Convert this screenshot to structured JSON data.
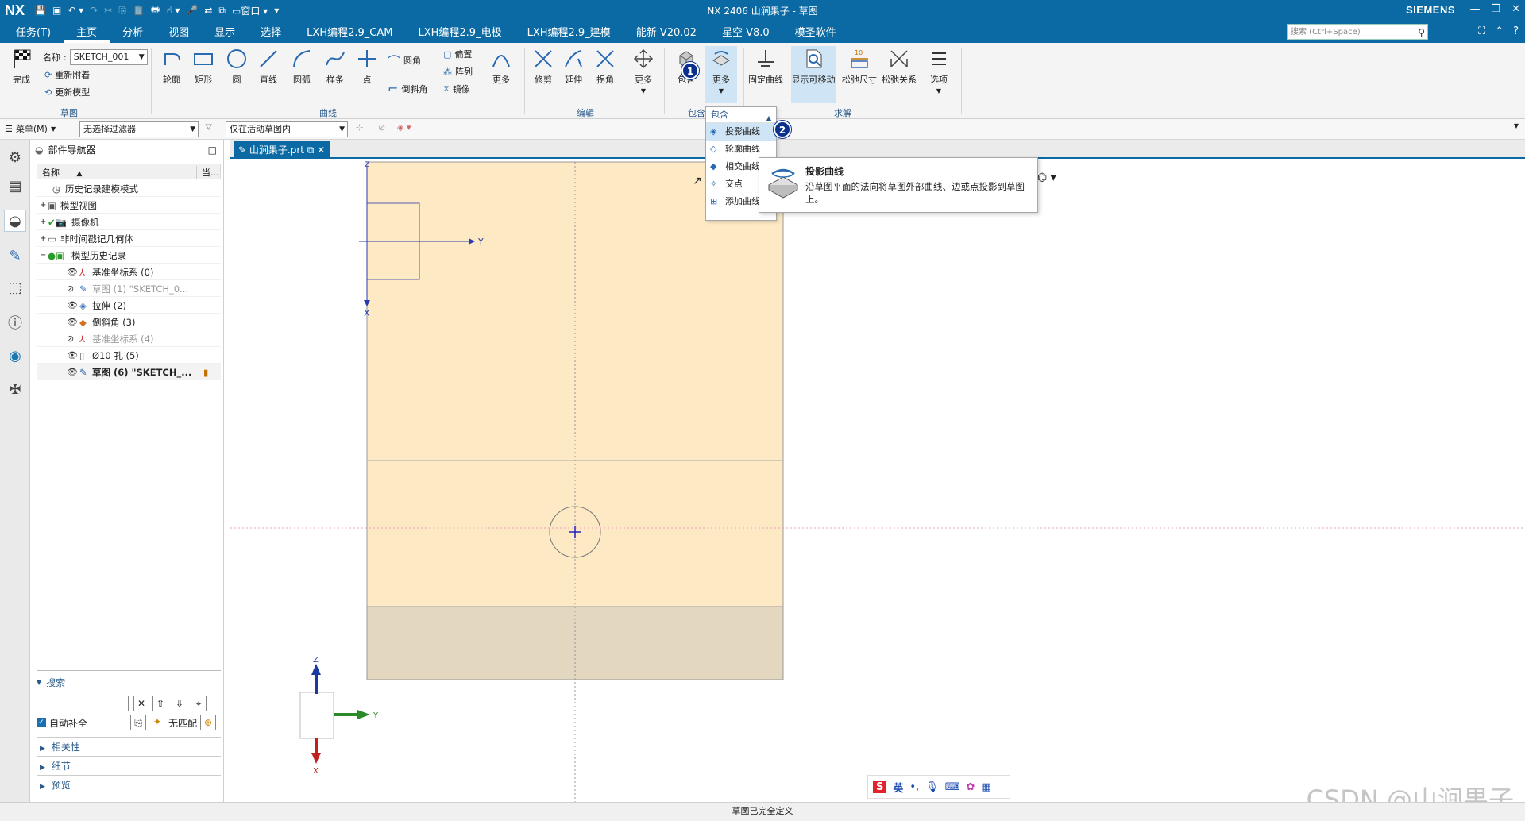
{
  "app": {
    "logo": "NX",
    "window_title": "NX 2406 山涧果子 - 草图",
    "brand": "SIEMENS",
    "window_menu_label": "窗口"
  },
  "menu": {
    "tabs": [
      "任务(T)",
      "主页",
      "分析",
      "视图",
      "显示",
      "选择",
      "LXH编程2.9_CAM",
      "LXH编程2.9_电极",
      "LXH编程2.9_建模",
      "能新 V20.02",
      "星空 V8.0",
      "模圣软件"
    ],
    "active_tab": "主页",
    "search_placeholder": "搜索 (Ctrl+Space)"
  },
  "ribbon": {
    "sketch_group": {
      "finish_label": "完成",
      "name_label": "名称",
      "name_value": "SKETCH_001",
      "reattach_label": "重新附着",
      "update_model_label": "更新模型",
      "group_label": "草图"
    },
    "curve_group": {
      "items": [
        "轮廓",
        "矩形",
        "圆",
        "直线",
        "圆弧",
        "样条",
        "点"
      ],
      "fillet_label": "圆角",
      "chamfer_label": "倒斜角",
      "offset_label": "偏置",
      "pattern_label": "阵列",
      "mirror_label": "镜像",
      "more_label": "更多",
      "group_label": "曲线"
    },
    "edit_group": {
      "items": [
        "修剪",
        "延伸",
        "拐角",
        "更多"
      ],
      "group_label": "编辑"
    },
    "include_group": {
      "include_label": "包含",
      "more_label": "更多",
      "group_label": "包含"
    },
    "solve_group": {
      "items": [
        "固定曲线",
        "显示可移动",
        "松弛尺寸",
        "松弛关系",
        "选项"
      ],
      "group_label": "求解"
    }
  },
  "selection_bar": {
    "menu_label": "菜单(M)",
    "filter_value": "无选择过滤器",
    "scope_value": "仅在活动草图内"
  },
  "navigator": {
    "title": "部件导航器",
    "col_name": "名称",
    "col_current": "当...",
    "rows": [
      {
        "label": "历史记录建模模式",
        "style": "normal"
      },
      {
        "label": "模型视图",
        "style": "normal"
      },
      {
        "label": "摄像机",
        "style": "normal"
      },
      {
        "label": "非时间戳记几何体",
        "style": "normal"
      },
      {
        "label": "模型历史记录",
        "style": "normal"
      },
      {
        "label": "基准坐标系 (0)",
        "style": "normal"
      },
      {
        "label": "草图 (1) \"SKETCH_0...",
        "style": "gray"
      },
      {
        "label": "拉伸 (2)",
        "style": "normal"
      },
      {
        "label": "倒斜角 (3)",
        "style": "normal"
      },
      {
        "label": "基准坐标系 (4)",
        "style": "gray"
      },
      {
        "label": "Ø10 孔 (5)",
        "style": "normal"
      },
      {
        "label": "草图 (6) \"SKETCH_...",
        "style": "bold"
      }
    ],
    "search_title": "搜索",
    "auto_complete_label": "自动补全",
    "no_match_label": "无匹配",
    "sections": [
      "相关性",
      "细节",
      "预览"
    ]
  },
  "graphics": {
    "file_tab": "山涧果子.prt",
    "axis_labels": {
      "z": "Z",
      "y": "Y",
      "x": "X"
    }
  },
  "dropdown": {
    "header": "包含",
    "items": [
      "投影曲线",
      "轮廓曲线",
      "相交曲线",
      "交点",
      "添加曲线"
    ],
    "highlighted": "投影曲线"
  },
  "tooltip": {
    "title": "投影曲线",
    "description": "沿草图平面的法向将草图外部曲线、边或点投影到草图上。"
  },
  "badges": [
    "1",
    "2"
  ],
  "ime": {
    "lang": "英"
  },
  "status": {
    "text": "草图已完全定义"
  },
  "watermark": "CSDN @山涧果子",
  "colors": {
    "accent": "#0b6aa3",
    "part_face": "#fde9c4",
    "part_chamfer": "#e4d7bf",
    "badge": "#0a2f8c"
  }
}
